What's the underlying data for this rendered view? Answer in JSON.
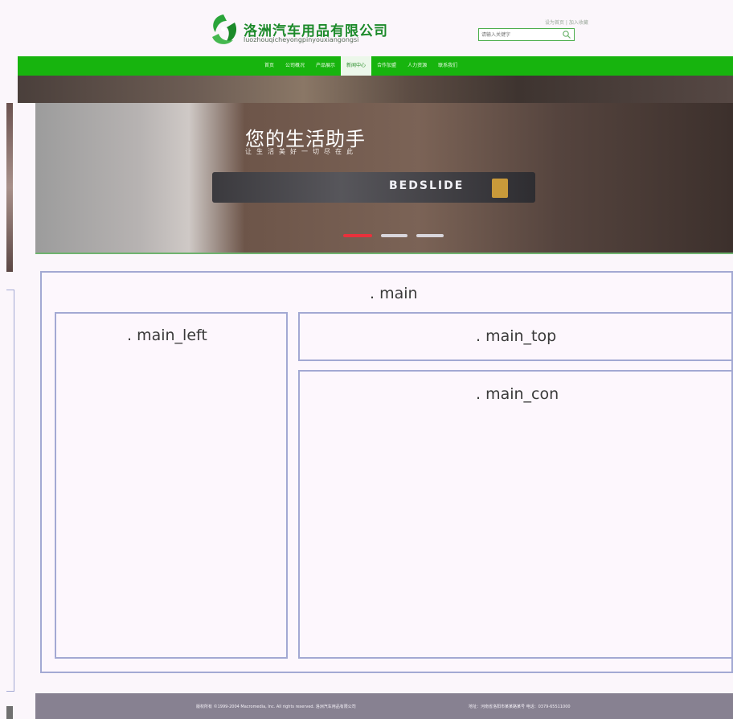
{
  "header": {
    "company_name": "洛洲汽车用品有限公司",
    "company_pinyin": "luozhouqicheyongpinyouxiangongsi",
    "top_link": "设为首页 | 加入收藏",
    "search_placeholder": "请输入关键字",
    "brand_color": "#17b40e"
  },
  "nav": {
    "items": [
      {
        "label": "首页"
      },
      {
        "label": "公司概况"
      },
      {
        "label": "产品展示"
      },
      {
        "label": "新闻中心",
        "active": true
      },
      {
        "label": "合作加盟"
      },
      {
        "label": "人力资源"
      },
      {
        "label": "联系我们"
      }
    ]
  },
  "banner": {
    "title": "您的生活助手",
    "subtitle": "让生活美好一切尽在此",
    "brand_text": "BEDSLIDE",
    "active_slide": 1,
    "slide_count": 3,
    "active_dot_color": "#e8313c"
  },
  "layout": {
    "main": ". main",
    "main_left": ". main_left",
    "main_top": ". main_top",
    "main_con": ". main_con"
  },
  "footer": {
    "copyright": "版权所有 ©1999-2004 Macromedia, Inc. All rights reserved. 洛洲汽车用品有限公司",
    "contact": "地址：河南省洛阳市某某路某号 电话：0379-65511000"
  }
}
